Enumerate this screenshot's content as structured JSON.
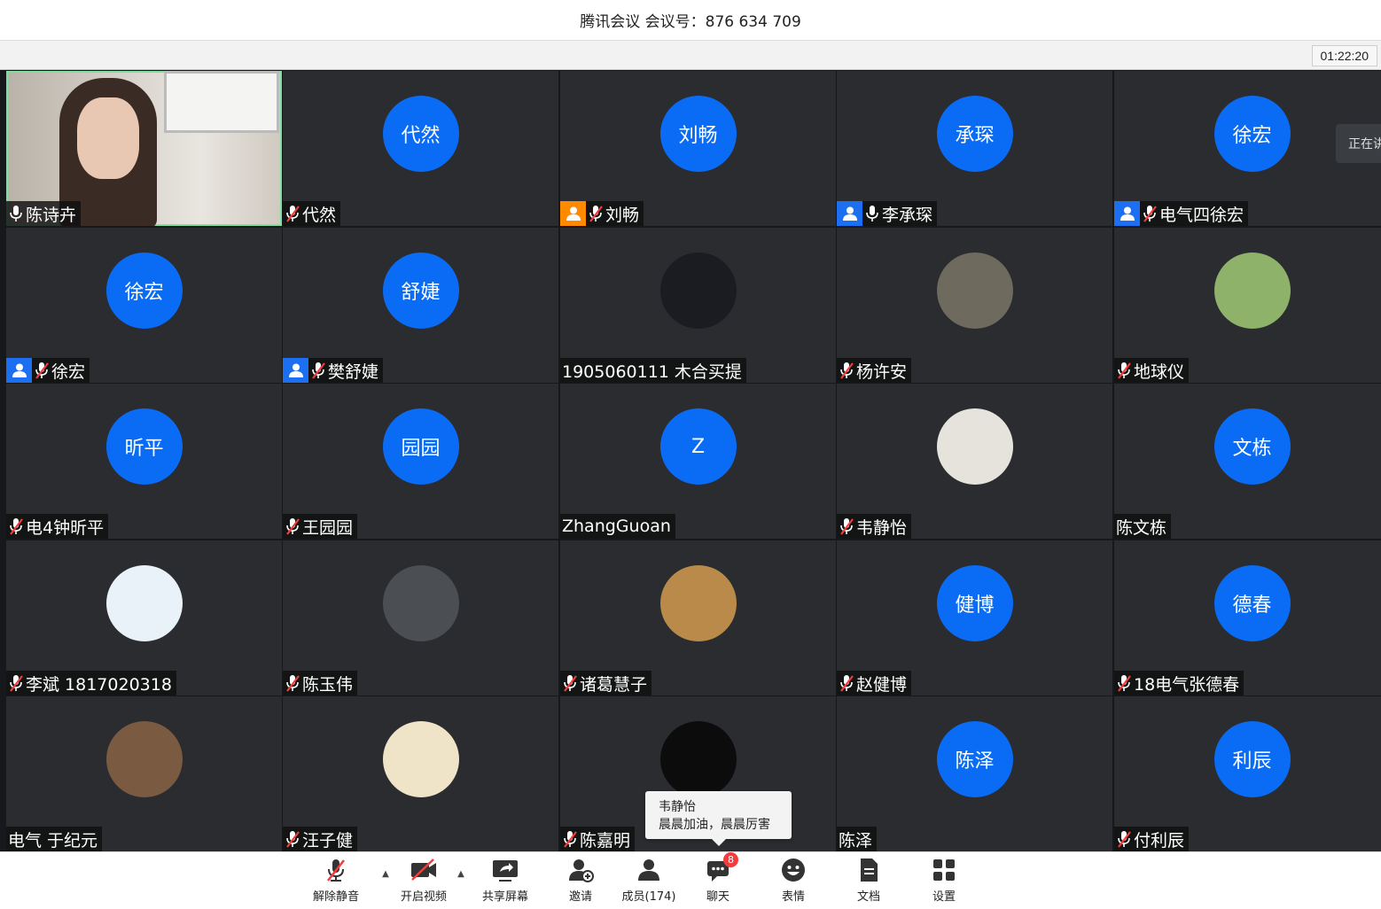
{
  "header": {
    "title": "腾讯会议 会议号：876 634 709",
    "timer": "01:22:20"
  },
  "side_tab": "正在讲",
  "tooltip": {
    "name": "韦静怡",
    "message": "晨晨加油，晨晨厉害"
  },
  "participants": [
    {
      "name": "陈诗卉",
      "avatar": "",
      "avatar_type": "video",
      "mic": "on",
      "badge": "",
      "active": true
    },
    {
      "name": "代然",
      "avatar": "代然",
      "avatar_type": "text",
      "mic": "muted",
      "badge": ""
    },
    {
      "name": "刘畅",
      "avatar": "刘畅",
      "avatar_type": "text",
      "mic": "muted",
      "badge": "orange"
    },
    {
      "name": "李承琛",
      "avatar": "承琛",
      "avatar_type": "text",
      "mic": "on",
      "badge": "blue"
    },
    {
      "name": "电气四徐宏",
      "avatar": "徐宏",
      "avatar_type": "text",
      "mic": "muted",
      "badge": "blue"
    },
    {
      "name": "徐宏",
      "avatar": "徐宏",
      "avatar_type": "text",
      "mic": "muted",
      "badge": "blue"
    },
    {
      "name": "樊舒婕",
      "avatar": "舒婕",
      "avatar_type": "text",
      "mic": "muted",
      "badge": "blue"
    },
    {
      "name": "1905060111 木合买提",
      "avatar": "",
      "avatar_type": "photo",
      "mic": "none",
      "badge": "",
      "photo_color": "#1b1b22"
    },
    {
      "name": "杨许安",
      "avatar": "",
      "avatar_type": "photo",
      "mic": "muted",
      "badge": "",
      "photo_color": "#6f6a5e"
    },
    {
      "name": "地球仪",
      "avatar": "",
      "avatar_type": "photo",
      "mic": "muted",
      "badge": "",
      "photo_color": "#8fb26a"
    },
    {
      "name": "电4钟昕平",
      "avatar": "昕平",
      "avatar_type": "text",
      "mic": "muted",
      "badge": ""
    },
    {
      "name": "王园园",
      "avatar": "园园",
      "avatar_type": "text",
      "mic": "muted",
      "badge": ""
    },
    {
      "name": "ZhangGuoan",
      "avatar": "Z",
      "avatar_type": "text",
      "mic": "none",
      "badge": ""
    },
    {
      "name": "韦静怡",
      "avatar": "",
      "avatar_type": "photo",
      "mic": "muted",
      "badge": "",
      "photo_color": "#e6e3dc"
    },
    {
      "name": "陈文栋",
      "avatar": "文栋",
      "avatar_type": "text",
      "mic": "none",
      "badge": ""
    },
    {
      "name": "李斌 1817020318",
      "avatar": "",
      "avatar_type": "photo",
      "mic": "muted",
      "badge": "",
      "photo_color": "#e9f1f9"
    },
    {
      "name": "陈玉伟",
      "avatar": "",
      "avatar_type": "photo",
      "mic": "muted",
      "badge": "",
      "photo_color": "#4b4e52"
    },
    {
      "name": "诸葛慧子",
      "avatar": "",
      "avatar_type": "photo",
      "mic": "muted",
      "badge": "",
      "photo_color": "#b98a4a"
    },
    {
      "name": "赵健博",
      "avatar": "健博",
      "avatar_type": "text",
      "mic": "muted",
      "badge": ""
    },
    {
      "name": "18电气张德春",
      "avatar": "德春",
      "avatar_type": "text",
      "mic": "muted",
      "badge": ""
    },
    {
      "name": "电气 于纪元",
      "avatar": "",
      "avatar_type": "photo",
      "mic": "none",
      "badge": "",
      "photo_color": "#7a5a40"
    },
    {
      "name": "汪子健",
      "avatar": "",
      "avatar_type": "photo",
      "mic": "muted",
      "badge": "",
      "photo_color": "#efe4c8"
    },
    {
      "name": "陈嘉明",
      "avatar": "",
      "avatar_type": "photo",
      "mic": "muted",
      "badge": "",
      "photo_color": "#0c0c0c"
    },
    {
      "name": "陈泽",
      "avatar": "陈泽",
      "avatar_type": "text",
      "mic": "none",
      "badge": ""
    },
    {
      "name": "付利辰",
      "avatar": "利辰",
      "avatar_type": "text",
      "mic": "muted",
      "badge": ""
    }
  ],
  "toolbar": {
    "unmute": "解除静音",
    "video": "开启视频",
    "share": "共享屏幕",
    "invite": "邀请",
    "members": "成员(174)",
    "chat": "聊天",
    "chat_badge": "8",
    "emoji": "表情",
    "docs": "文档",
    "settings": "设置"
  },
  "colors": {
    "avatar_blue": "#0a6cf5",
    "badge_blue": "#1d6ff2",
    "badge_orange": "#ff8a00",
    "mute_red": "#f43c3c",
    "active_border": "#7ee0a0"
  }
}
